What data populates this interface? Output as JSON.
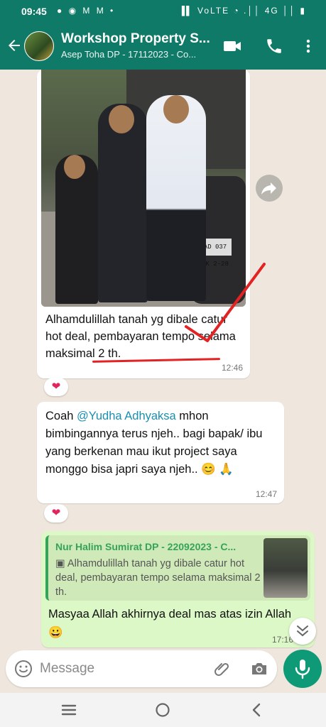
{
  "status_bar": {
    "time": "09:45",
    "left_icons": "● ◉ M M •",
    "right_icons": "▐▌ VoLTE ◔ .││ 4G ││ ▮"
  },
  "header": {
    "title": "Workshop Property S...",
    "subtitle": "Asep Toha DP - 17112023 - Co..."
  },
  "messages": [
    {
      "text": "Alhamdulillah tanah yg dibale catur hot deal, pembayaran tempo selama maksimal 2 th.",
      "time": "12:46",
      "reaction": "❤",
      "photo_plate": "AD 037 AK\n2-28"
    },
    {
      "text_prefix": "Coah ",
      "mention": "@Yudha Adhyaksa",
      "text_suffix": "  mhon bimbingannya terus njeh.. bagi bapak/ ibu yang berkenan mau ikut project saya monggo bisa japri saya njeh.. 😊 🙏",
      "time": "12:47",
      "reaction": "❤"
    },
    {
      "quote_name": "Nur Halim Sumirat DP - 22092023 - C...",
      "quote_text": "▣ Alhamdulillah tanah yg dibale catur hot deal, pembayaran tempo selama maksimal 2 th.",
      "text": "Masyaa Allah akhirnya deal mas atas izin Allah 😀",
      "time": "17:16"
    }
  ],
  "input": {
    "placeholder": "Message"
  },
  "colors": {
    "header": "#0f7a67",
    "background": "#efe7dd",
    "outgoing_bubble": "#dcf8c6",
    "mention": "#1a8fb0",
    "quote_accent": "#35a35a",
    "mic_button": "#0f9a77",
    "annotation_red": "#e32323"
  },
  "icons": [
    "back-arrow-icon",
    "video-call-icon",
    "phone-call-icon",
    "more-options-icon",
    "forward-icon",
    "heart-icon",
    "emoji-icon",
    "attach-icon",
    "camera-icon",
    "mic-icon",
    "chevron-down-icon",
    "nav-recents-icon",
    "nav-home-icon",
    "nav-back-icon"
  ]
}
